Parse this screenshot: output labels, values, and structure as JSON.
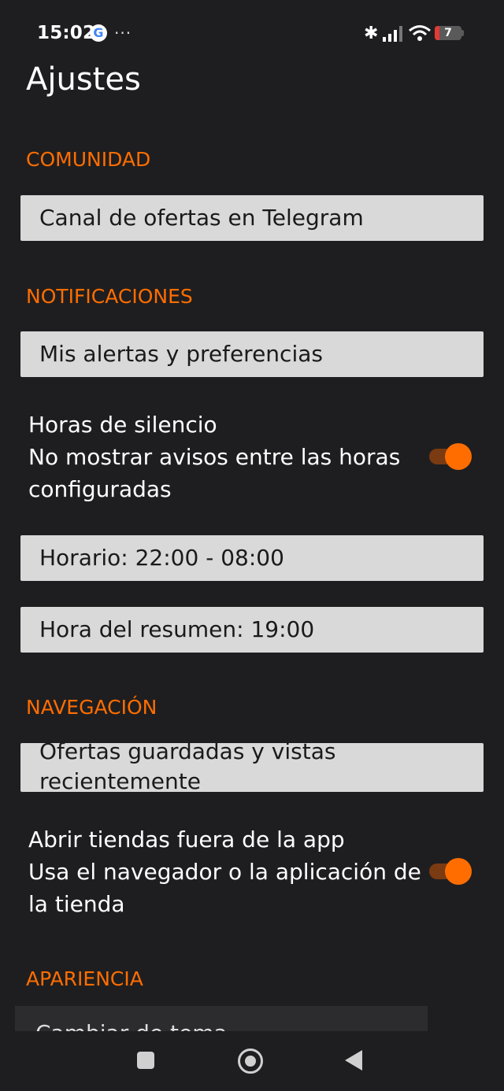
{
  "status_bar": {
    "time": "15:02",
    "google_letter": "G",
    "more": "···",
    "bluetooth": "✱",
    "battery_level": "7"
  },
  "title": "Ajustes",
  "sections": {
    "community": {
      "header": "COMUNIDAD",
      "telegram_button": "Canal de ofertas en Telegram"
    },
    "notifications": {
      "header": "NOTIFICACIONES",
      "alerts_button": "Mis alertas y preferencias",
      "quiet_hours": {
        "title": "Horas de silencio",
        "description": "No mostrar avisos entre las horas configuradas",
        "enabled": true
      },
      "schedule_button": "Horario: 22:00 - 08:00",
      "summary_button": "Hora del resumen: 19:00"
    },
    "navigation": {
      "header": "NAVEGACIÓN",
      "saved_button": "Ofertas guardadas y vistas recientemente",
      "open_stores": {
        "title": "Abrir tiendas fuera de la app",
        "description": "Usa el navegador o la aplicación de la tienda",
        "enabled": true
      }
    },
    "appearance": {
      "header": "APARIENCIA",
      "partial_item": "Cambiar de tema"
    }
  },
  "colors": {
    "background": "#1e1e20",
    "accent": "#ff6d00",
    "button_bg": "#d9d9d9"
  },
  "icons": {
    "status": [
      "google-icon",
      "more-icon",
      "bluetooth-icon",
      "signal-icon",
      "wifi-icon",
      "battery-icon"
    ],
    "nav": [
      "recents-square-icon",
      "home-circle-icon",
      "back-triangle-icon"
    ]
  }
}
